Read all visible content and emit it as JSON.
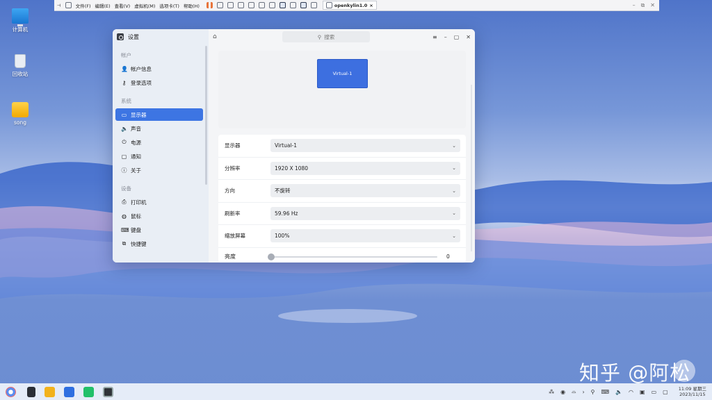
{
  "vm": {
    "menus": [
      "文件(F)",
      "编辑(E)",
      "查看(V)",
      "虚拟机(M)",
      "选项卡(T)",
      "帮助(H)"
    ],
    "tab_title": "openkylin1.0"
  },
  "desktop": {
    "icons": [
      {
        "label": "计算机",
        "icon": "computer-icon"
      },
      {
        "label": "回收站",
        "icon": "trash-icon"
      },
      {
        "label": "song",
        "icon": "folder-icon"
      }
    ]
  },
  "window": {
    "title": "设置",
    "search_placeholder": "搜索",
    "groups": [
      {
        "title": "帐户",
        "items": [
          {
            "label": "帐户信息",
            "icon": "user-icon",
            "glyph": "👤"
          },
          {
            "label": "登录选项",
            "icon": "key-icon",
            "glyph": "⚷"
          }
        ]
      },
      {
        "title": "系统",
        "items": [
          {
            "label": "显示器",
            "icon": "monitor-icon",
            "glyph": "▭",
            "active": true
          },
          {
            "label": "声音",
            "icon": "speaker-icon",
            "glyph": "🔈"
          },
          {
            "label": "电源",
            "icon": "power-icon",
            "glyph": "⏻"
          },
          {
            "label": "通知",
            "icon": "notification-icon",
            "glyph": "▢"
          },
          {
            "label": "关于",
            "icon": "info-icon",
            "glyph": "ⓘ"
          }
        ]
      },
      {
        "title": "设备",
        "items": [
          {
            "label": "打印机",
            "icon": "printer-icon",
            "glyph": "⎙"
          },
          {
            "label": "鼠标",
            "icon": "mouse-icon",
            "glyph": "◍"
          },
          {
            "label": "键盘",
            "icon": "keyboard-icon",
            "glyph": "⌨"
          },
          {
            "label": "快捷键",
            "icon": "shortcut-icon",
            "glyph": "⧉"
          }
        ]
      }
    ],
    "preview": {
      "monitor_name": "Virtual-1"
    },
    "settings": [
      {
        "label": "显示器",
        "value": "Virtual-1"
      },
      {
        "label": "分辨率",
        "value": "1920 X 1080"
      },
      {
        "label": "方向",
        "value": "不旋转"
      },
      {
        "label": "刷新率",
        "value": "59.96 Hz"
      },
      {
        "label": "缩放屏幕",
        "value": "100%"
      }
    ],
    "brightness": {
      "label": "亮度",
      "value": "0"
    }
  },
  "watermark": "知乎 @阿松",
  "taskbar": {
    "time": "11:09 星期三",
    "date": "2023/11/15"
  },
  "colors": {
    "accent": "#3d75e3"
  }
}
